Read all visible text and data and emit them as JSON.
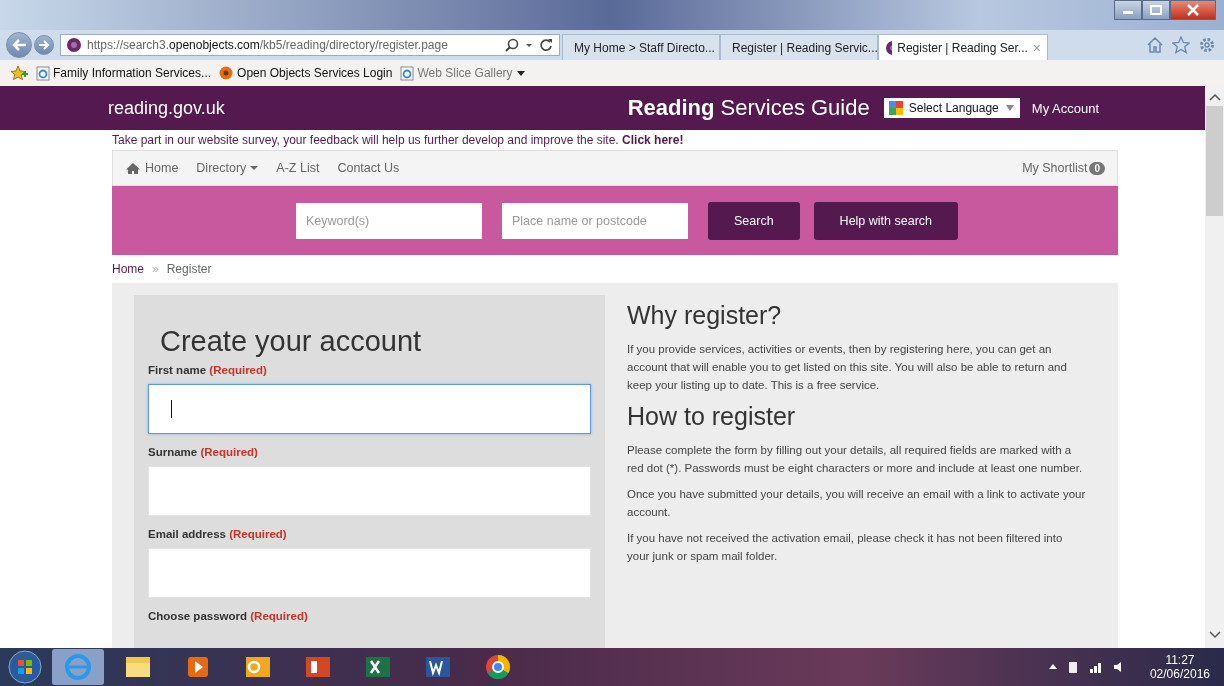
{
  "browser": {
    "address": {
      "prefix": "https://search3.",
      "domain": "openobjects.com",
      "path": "/kb5/reading/directory/register.page"
    },
    "tabs": [
      {
        "label": "My Home > Staff Directo...",
        "kind": "ie",
        "selected": false
      },
      {
        "label": "Register | Reading Servic...",
        "kind": "site",
        "selected": false
      },
      {
        "label": "Register | Reading Ser...",
        "kind": "site",
        "selected": true,
        "close": "×"
      }
    ],
    "favorites": [
      {
        "label": "Family Information Services...",
        "kind": "ie",
        "dropdown": false
      },
      {
        "label": "Open Objects Services Login",
        "kind": "oo",
        "dropdown": false
      },
      {
        "label": "Web Slice Gallery",
        "kind": "ie",
        "dropdown": true
      }
    ]
  },
  "header": {
    "logo": "reading.gov.uk",
    "title": "**Reading** Services Guide",
    "language": "Select Language",
    "account": "My Account"
  },
  "survey": {
    "text": "Take part in our website survey, your feedback will help us further develop and improve the site.",
    "link": "Click here!"
  },
  "nav": {
    "items": [
      {
        "label": "Home",
        "kind": "home"
      },
      {
        "label": "Directory",
        "kind": "dropdown"
      },
      {
        "label": "A-Z List",
        "kind": "plain"
      },
      {
        "label": "Contact Us",
        "kind": "plain"
      }
    ],
    "shortlist": "My Shortlist",
    "shortlist_count": "0"
  },
  "search": {
    "keyword_placeholder": "Keyword(s)",
    "place_placeholder": "Place name or postcode",
    "buttons": [
      "Search",
      "Help with search"
    ]
  },
  "breadcrumb": {
    "separator": "»",
    "items": [
      {
        "label": "Home",
        "link": true
      },
      {
        "label": "Register",
        "link": false
      }
    ]
  },
  "form": {
    "title": "Create your account",
    "fields": [
      {
        "label": "First name",
        "note": "(Required)",
        "focused": true
      },
      {
        "label": "Surname",
        "note": "(Required)",
        "focused": false
      },
      {
        "label": "Email address",
        "note": "(Required)",
        "focused": false
      },
      {
        "label": "Choose password",
        "note": "(Required)"
      }
    ]
  },
  "info": [
    {
      "heading": "Why register?",
      "paragraphs": [
        "If you provide services, activities or events, then by registering here, you can get an account that will enable you to get listed on this site.  You will also be able to return and keep your listing up to date.  This is a free service."
      ]
    },
    {
      "heading": "How to register",
      "paragraphs": [
        "Please complete the form by filling out your details, all required fields are marked with a red dot (*). Passwords must be eight characters or more and include at least one number.",
        "Once you have submitted your details, you will receive an email with a link to activate your account.",
        "If you have not received the activation email, please check it has not been filtered into your junk or spam mail folder."
      ]
    }
  ],
  "taskbar": {
    "time": "11:27",
    "date": "02/06/2016"
  }
}
